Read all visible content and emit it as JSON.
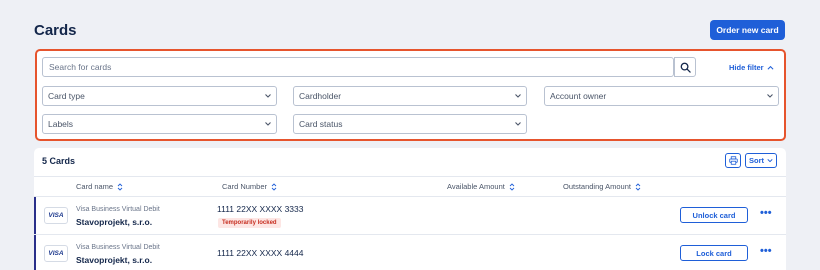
{
  "header": {
    "title": "Cards",
    "order_button": "Order new card"
  },
  "filters": {
    "search_placeholder": "Search for cards",
    "hide_filter": "Hide filter",
    "card_type": "Card type",
    "cardholder": "Cardholder",
    "account_owner": "Account owner",
    "labels": "Labels",
    "card_status": "Card status"
  },
  "list": {
    "title": "5 Cards",
    "sort_label": "Sort",
    "columns": [
      "Card name",
      "Card Number",
      "Available Amount",
      "Outstanding Amount"
    ],
    "rows": [
      {
        "brand": "VISA",
        "card_type": "Visa Business Virtual Debit",
        "holder": "Stavoprojekt, s.r.o.",
        "number": "1111 22XX XXXX 3333",
        "badge": "Temporarily locked",
        "action": "Unlock card",
        "more": "•••"
      },
      {
        "brand": "VISA",
        "card_type": "Visa Business Virtual Debit",
        "holder": "Stavoprojekt, s.r.o.",
        "number": "1111 22XX XXXX 4444",
        "action": "Lock card",
        "more": "•••"
      }
    ]
  },
  "colors": {
    "accent": "#1f5fd8",
    "highlight": "#e6542d",
    "locked": "#c62d1f"
  }
}
